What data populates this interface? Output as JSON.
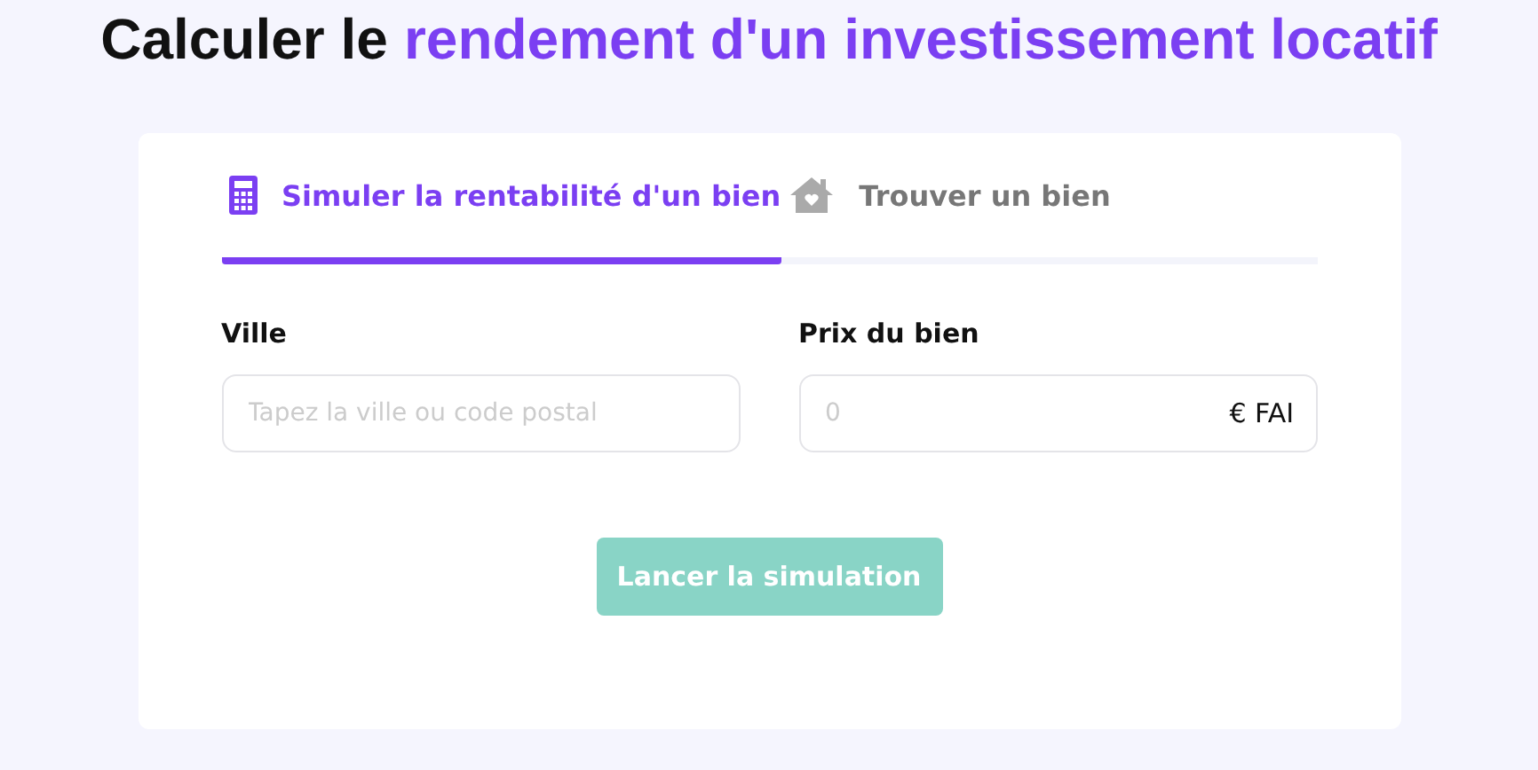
{
  "title": {
    "lead": "Calculer le",
    "highlight": "rendement d'un investissement locatif"
  },
  "tabs": [
    {
      "label": "Simuler la rentabilité d'un bien",
      "kind": "calculator",
      "selected": true
    },
    {
      "label": "Trouver un bien",
      "kind": "house",
      "selected": false
    }
  ],
  "fields": [
    {
      "label": "Ville",
      "placeholder": "Tapez la ville ou code postal"
    },
    {
      "label": "Prix du bien",
      "placeholder": "0",
      "suffix": "€ FAI"
    }
  ],
  "button": {
    "label": "Lancer la simulation",
    "disabled": true
  }
}
